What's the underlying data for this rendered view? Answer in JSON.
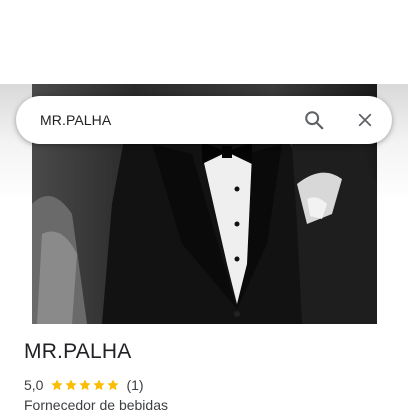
{
  "search": {
    "query": "MR.PALHA"
  },
  "icons": {
    "search": "search-icon",
    "close": "close-icon",
    "star": "star-icon"
  },
  "place": {
    "name": "MR.PALHA",
    "rating": "5,0",
    "rating_value": 5.0,
    "review_count": "(1)",
    "category": "Fornecedor de bebidas"
  },
  "colors": {
    "star": "#fbbc04",
    "text": "#202124",
    "icon": "#5f6368"
  }
}
